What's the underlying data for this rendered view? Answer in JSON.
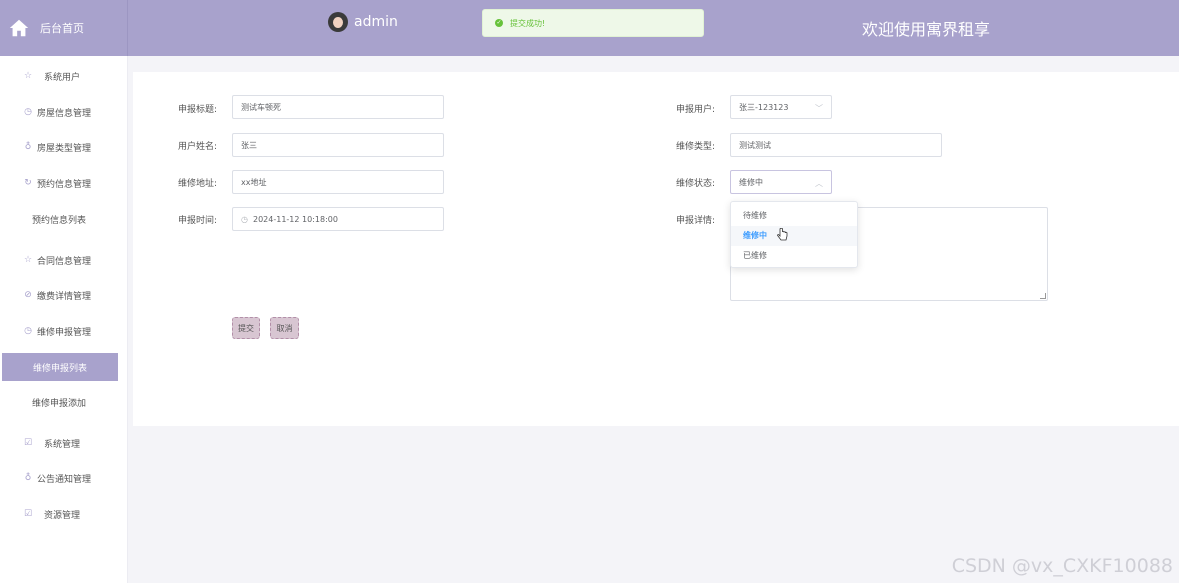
{
  "header": {
    "home_label": "后台首页",
    "username": "admin",
    "toast_message": "提交成功!",
    "welcome": "欢迎使用寓界租享"
  },
  "sidebar": {
    "items": [
      {
        "label": "系统用户",
        "icon": "star-icon"
      },
      {
        "label": "房屋信息管理",
        "icon": "clock-icon"
      },
      {
        "label": "房屋类型管理",
        "icon": "trash-icon"
      },
      {
        "label": "预约信息管理",
        "icon": "refresh-icon"
      },
      {
        "label": "预约信息列表",
        "icon": ""
      },
      {
        "label": "合同信息管理",
        "icon": "star-icon"
      },
      {
        "label": "缴费详情管理",
        "icon": "check-circle-icon"
      },
      {
        "label": "维修申报管理",
        "icon": "clock-icon"
      },
      {
        "label": "维修申报列表",
        "icon": "",
        "active": true
      },
      {
        "label": "维修申报添加",
        "icon": ""
      },
      {
        "label": "系统管理",
        "icon": "checkbox-icon"
      },
      {
        "label": "公告通知管理",
        "icon": "trash-icon"
      },
      {
        "label": "资源管理",
        "icon": "checkbox-icon"
      }
    ]
  },
  "form": {
    "title_label": "申报标题:",
    "title_value": "测试车顿死",
    "name_label": "用户姓名:",
    "name_value": "张三",
    "address_label": "维修地址:",
    "address_value": "xx地址",
    "time_label": "申报时间:",
    "time_value": "2024-11-12 10:18:00",
    "user_label": "申报用户:",
    "user_value": "张三-123123",
    "type_label": "维修类型:",
    "type_value": "测试测试",
    "status_label": "维修状态:",
    "status_value": "维修中",
    "detail_label": "申报详情:",
    "status_options": [
      "待维修",
      "维修中",
      "已维修"
    ],
    "submit_label": "提交",
    "cancel_label": "取消"
  },
  "watermark": "CSDN @vx_CXKF10088",
  "colors": {
    "theme": "#a8a2cc",
    "success": "#67c23a",
    "selected": "#409eff",
    "button": "#d8c6d2"
  }
}
